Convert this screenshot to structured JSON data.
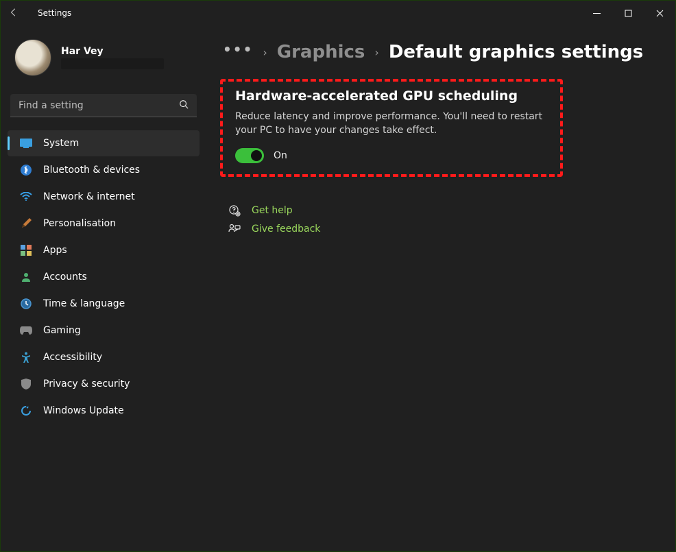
{
  "window": {
    "title": "Settings"
  },
  "profile": {
    "display_name": "Har Vey"
  },
  "search": {
    "placeholder": "Find a setting"
  },
  "sidebar": {
    "items": [
      {
        "label": "System"
      },
      {
        "label": "Bluetooth & devices"
      },
      {
        "label": "Network & internet"
      },
      {
        "label": "Personalisation"
      },
      {
        "label": "Apps"
      },
      {
        "label": "Accounts"
      },
      {
        "label": "Time & language"
      },
      {
        "label": "Gaming"
      },
      {
        "label": "Accessibility"
      },
      {
        "label": "Privacy & security"
      },
      {
        "label": "Windows Update"
      }
    ],
    "selected_index": 0
  },
  "breadcrumb": {
    "parent": "Graphics",
    "current": "Default graphics settings"
  },
  "setting_card": {
    "title": "Hardware-accelerated GPU scheduling",
    "description": "Reduce latency and improve performance. You'll need to restart your PC to have your changes take effect.",
    "toggle_state_label": "On",
    "toggle_on": true
  },
  "support": {
    "get_help": "Get help",
    "give_feedback": "Give feedback"
  },
  "colors": {
    "accent_green": "#99d65c",
    "toggle_on": "#3bbf3b",
    "highlight_border": "#ff1a1a"
  }
}
